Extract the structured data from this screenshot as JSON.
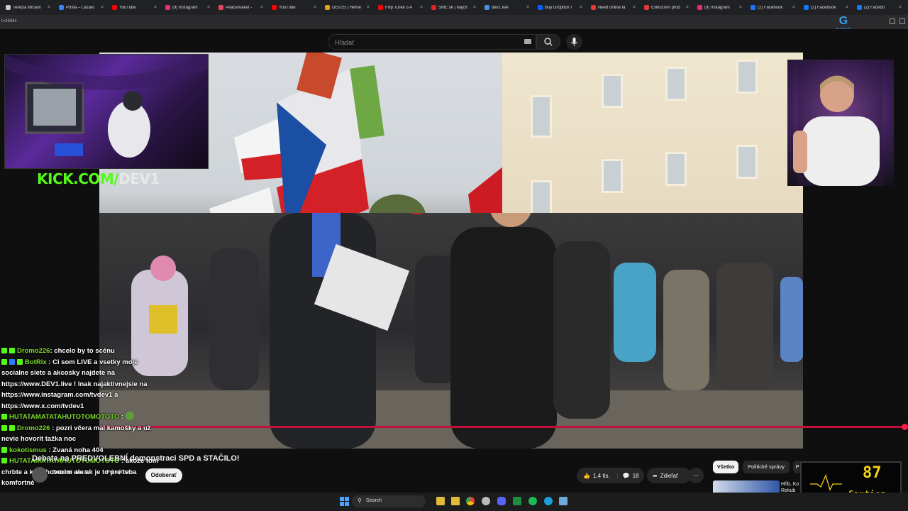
{
  "browser": {
    "tabs": [
      {
        "label": "Terézia Mičiani",
        "color": "#cccccc"
      },
      {
        "label": "Pošta – Lazaro",
        "color": "#3b82f6"
      },
      {
        "label": "YouTube",
        "color": "#ff0000"
      },
      {
        "label": "(9) Instagram",
        "color": "#e1306c"
      },
      {
        "label": "Peacemaker -",
        "color": "#e94560"
      },
      {
        "label": "YouTube",
        "color": "#ff0000"
      },
      {
        "label": "DEV1S | Herné",
        "color": "#e0a020"
      },
      {
        "label": "Filip Turek o A",
        "color": "#ff0000"
      },
      {
        "label": "SME.sk | Najčít",
        "color": "#d9242a"
      },
      {
        "label": "dev1.live",
        "color": "#4a90e2"
      },
      {
        "label": "Buy Dropbox I",
        "color": "#0061ff"
      },
      {
        "label": "Need online la",
        "color": "#e53935"
      },
      {
        "label": "Exkluzívni prúd",
        "color": "#e53935"
      },
      {
        "label": "(9) Instagram",
        "color": "#e1306c"
      },
      {
        "label": "(2) Facebook",
        "color": "#1877f2"
      },
      {
        "label": "(2) Facebook",
        "color": "#1877f2"
      },
      {
        "label": "(2) Facebo",
        "color": "#1877f2"
      }
    ],
    "url_fragment": "t=2634s",
    "brand": "logitech"
  },
  "youtube": {
    "search_placeholder": "Hľadať",
    "video_title": "Debata na PREDVOLEBNÍ demonstraci SPD a STAČILO!",
    "channel_name": "Debatní deník",
    "join_label": "Pripojiť sa",
    "subscribe_label": "Odoberať",
    "like_count": "1,4 tis.",
    "comment_count": "18",
    "share_label": "Zdieľať",
    "more_label": "⋯",
    "progress_fraction": 0.99,
    "chips": [
      "Všetko",
      "Politické správy",
      "P"
    ],
    "rec_title_line1": "Hřib, Ko",
    "rec_title_line2": "Rekub"
  },
  "overlay": {
    "kick_part1": "KICK.COM/",
    "kick_part2": "DEV1",
    "caution_value": "87",
    "caution_label": "Caution"
  },
  "chat": [
    {
      "user": "Dromo226",
      "sep": ":",
      "text": "chcelo by to scénu",
      "badges": 2
    },
    {
      "user": "BotRix",
      "sep": ":",
      "text": "Ci som LIVE a vsetky moje socialne siete a akcosky najdete na https://www.DEV1.live ! Inak najaktivnejsie na https://www.instagram.com/tvdev1 a https://www.x.com/tvdev1",
      "badges": 3
    },
    {
      "user": "HUTATAMATATAHUTOTOMOTOTO",
      "sep": ":",
      "text": "",
      "badges": 1
    },
    {
      "user": "Dromo226",
      "sep": ":",
      "text": "pozri včera mal kamošky a už nevie hovorit tažka noc",
      "badges": 2
    },
    {
      "user": "kokotismus",
      "sep": ":",
      "text": "Zvaná noha 404",
      "badges": 1
    },
    {
      "user": "HUTATAMATATAHUTOTOMOTOTO",
      "sep": ":",
      "text": "akože tom chrbte a krku hovorim ale ak je to pre teba komfortné",
      "badges": 1
    }
  ],
  "taskbar": {
    "search_label": "Search",
    "icons": [
      "file-explorer-icon",
      "chrome-icon",
      "steam-icon",
      "discord-icon",
      "sheets-icon",
      "spotify-icon",
      "browser-icon",
      "app-icon"
    ]
  }
}
